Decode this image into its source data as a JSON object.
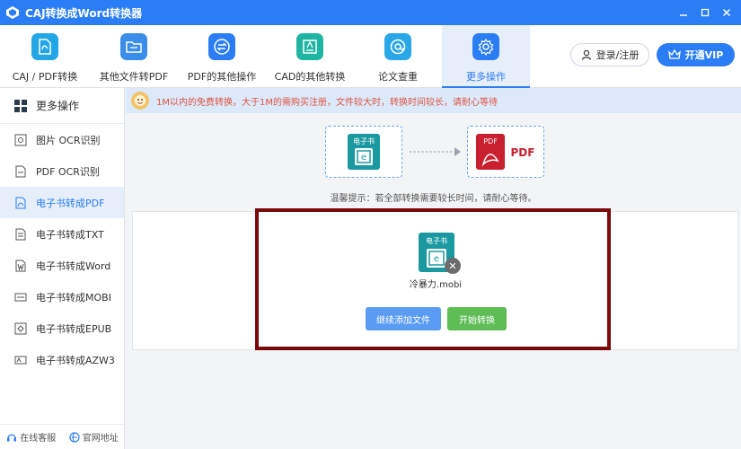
{
  "window": {
    "title": "CAJ转换成Word转换器",
    "controls": [
      "minimize-icon",
      "maximize-icon",
      "close-icon"
    ]
  },
  "toolbar": {
    "items": [
      {
        "label": "CAJ / PDF转换",
        "icon": "pdf-convert-icon",
        "color": "#22a6e6"
      },
      {
        "label": "其他文件转PDF",
        "icon": "folder-icon",
        "color": "#3a8de8"
      },
      {
        "label": "PDF的其他操作",
        "icon": "swap-icon",
        "color": "#2a7df5"
      },
      {
        "label": "CAD的其他转换",
        "icon": "cad-icon",
        "color": "#1fb5a2"
      },
      {
        "label": "论文查重",
        "icon": "at-icon",
        "color": "#2aa7e8"
      },
      {
        "label": "更多操作",
        "icon": "gear-icon",
        "color": "#2a7df5",
        "active": true
      }
    ],
    "login_label": "登录/注册",
    "vip_label": "开通VIP"
  },
  "sidebar": {
    "header": "更多操作",
    "items": [
      {
        "label": "图片 OCR识别",
        "icon": "image-ocr-icon"
      },
      {
        "label": "PDF OCR识别",
        "icon": "pdf-ocr-icon"
      },
      {
        "label": "电子书转成PDF",
        "icon": "ebook-pdf-icon",
        "active": true
      },
      {
        "label": "电子书转成TXT",
        "icon": "ebook-txt-icon"
      },
      {
        "label": "电子书转成Word",
        "icon": "ebook-word-icon"
      },
      {
        "label": "电子书转成MOBI",
        "icon": "ebook-mobi-icon"
      },
      {
        "label": "电子书转成EPUB",
        "icon": "ebook-epub-icon"
      },
      {
        "label": "电子书转成AZW3",
        "icon": "ebook-azw3-icon"
      }
    ],
    "footer": {
      "support_label": "在线客服",
      "website_label": "官网地址"
    }
  },
  "main": {
    "notice": "1M以内的免费转换，大于1M的需购买注册，文件较大时，转换时间较长，请耐心等待",
    "flow": {
      "source_label": "电子书",
      "target_label": "PDF",
      "target_text": "PDF"
    },
    "tip": "温馨提示：若全部转换需要较长时间，请耐心等待。",
    "file": {
      "icon_label": "电子书",
      "name": "冷暴力.mobi"
    },
    "add_button": "继续添加文件",
    "start_button": "开始转换"
  },
  "colors": {
    "accent": "#2a7df5",
    "highlight_border": "#7a0a0a",
    "notice_text": "#e2533c",
    "start_button": "#5ebd55"
  }
}
